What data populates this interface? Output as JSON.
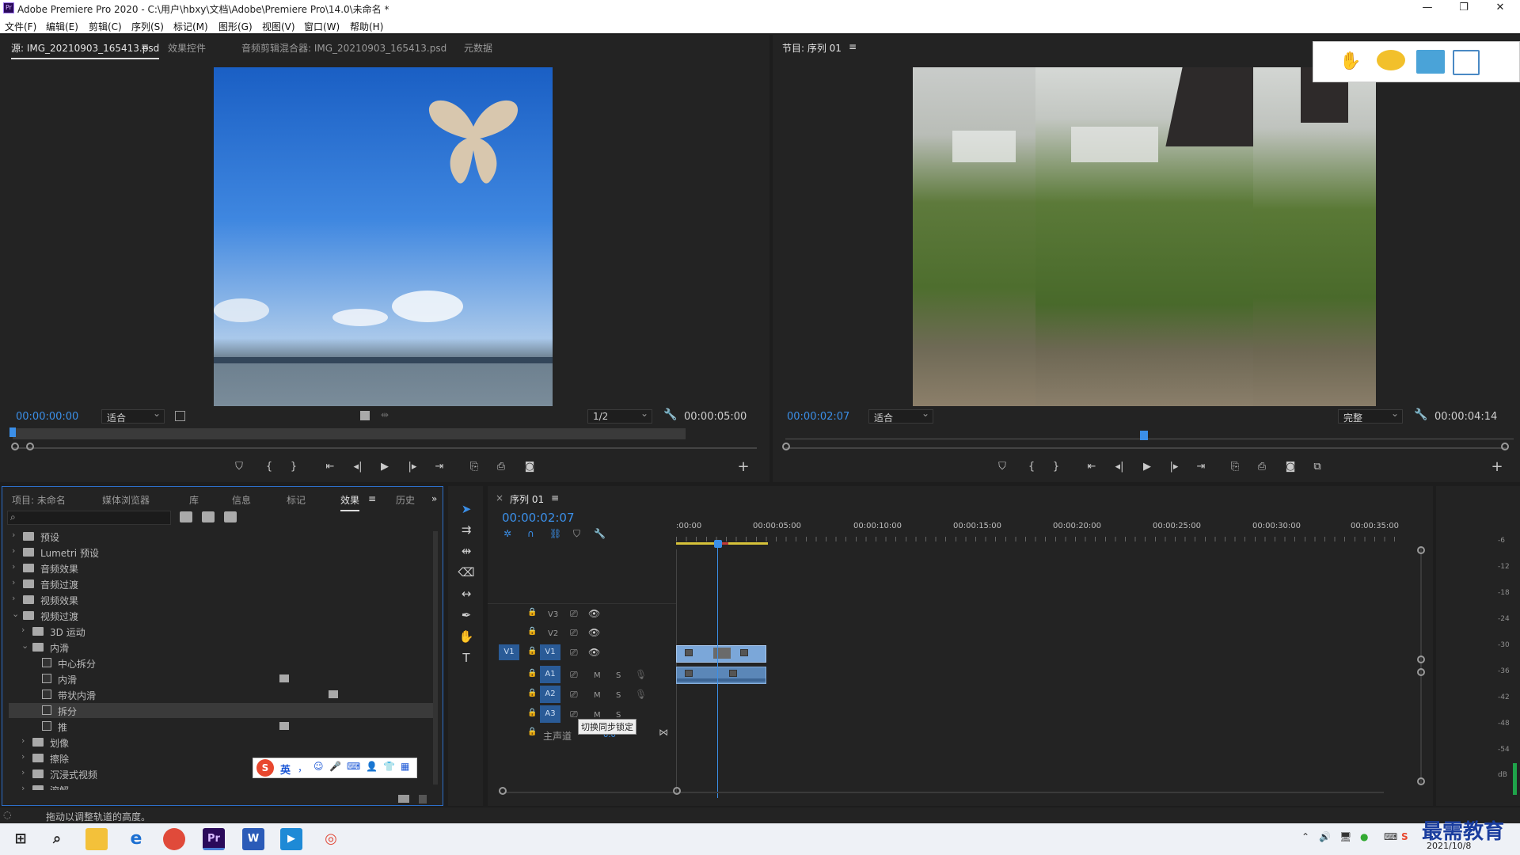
{
  "window": {
    "app_icon": "Pr",
    "title": "Adobe Premiere Pro 2020 - C:\\用户\\hbxy\\文档\\Adobe\\Premiere Pro\\14.0\\未命名 *",
    "minimize": "—",
    "maximize": "❐",
    "close": "✕"
  },
  "menu": [
    "文件(F)",
    "编辑(E)",
    "剪辑(C)",
    "序列(S)",
    "标记(M)",
    "图形(G)",
    "视图(V)",
    "窗口(W)",
    "帮助(H)"
  ],
  "source": {
    "tabs": [
      "源: IMG_20210903_165413.psd",
      "效果控件",
      "音频剪辑混合器: IMG_20210903_165413.psd",
      "元数据"
    ],
    "menu_icon": "≡",
    "timecode": "00:00:00:00",
    "fit": "适合",
    "resolution": "1/2",
    "duration": "00:00:05:00"
  },
  "program": {
    "tab": "节目: 序列 01",
    "menu_icon": "≡",
    "timecode": "00:00:02:07",
    "fit": "适合",
    "quality": "完整",
    "duration": "00:00:04:14"
  },
  "project": {
    "tabs": [
      "项目: 未命名",
      "媒体浏览器",
      "库",
      "信息",
      "标记",
      "效果",
      "历史"
    ],
    "more": "»",
    "menu_icon": "≡",
    "search_placeholder": "",
    "tree": [
      "预设",
      "Lumetri 预设",
      "音频效果",
      "音频过渡",
      "视频效果",
      "视频过渡",
      "3D 运动",
      "内滑",
      "中心拆分",
      "内滑",
      "带状内滑",
      "拆分",
      "推",
      "划像",
      "擦除",
      "沉浸式视频",
      "溶解"
    ]
  },
  "timeline": {
    "tab": "序列 01",
    "close": "×",
    "menu_icon": "≡",
    "timecode": "00:00:02:07",
    "ruler": [
      ":00:00",
      "00:00:05:00",
      "00:00:10:00",
      "00:00:15:00",
      "00:00:20:00",
      "00:00:25:00",
      "00:00:30:00",
      "00:00:35:00"
    ],
    "video_tracks": [
      "V3",
      "V2",
      "V1"
    ],
    "source_patch": "V1",
    "audio_tracks": [
      "A1",
      "A2",
      "A3"
    ],
    "mute": "M",
    "solo": "S",
    "master": "主声道",
    "master_value": "0.0",
    "tooltip": "切换同步锁定"
  },
  "meter": [
    "-6",
    "-12",
    "-18",
    "-24",
    "-30",
    "-36",
    "-42",
    "-48",
    "-54",
    "dB"
  ],
  "ime": {
    "logo": "S",
    "mode": "英",
    "items": [
      "，",
      "☺",
      "🎤",
      "⌨",
      "👤",
      "👕",
      "▦"
    ]
  },
  "status": "拖动以调整轨道的高度。",
  "taskbar": {
    "date": "2021/10/8",
    "watermark": "最需教育"
  },
  "colors": {
    "accent": "#3b8fe8",
    "clip_video": "#7ba7d9",
    "clip_audio": "#5b87b8",
    "playhead": "#3b8fe8"
  }
}
